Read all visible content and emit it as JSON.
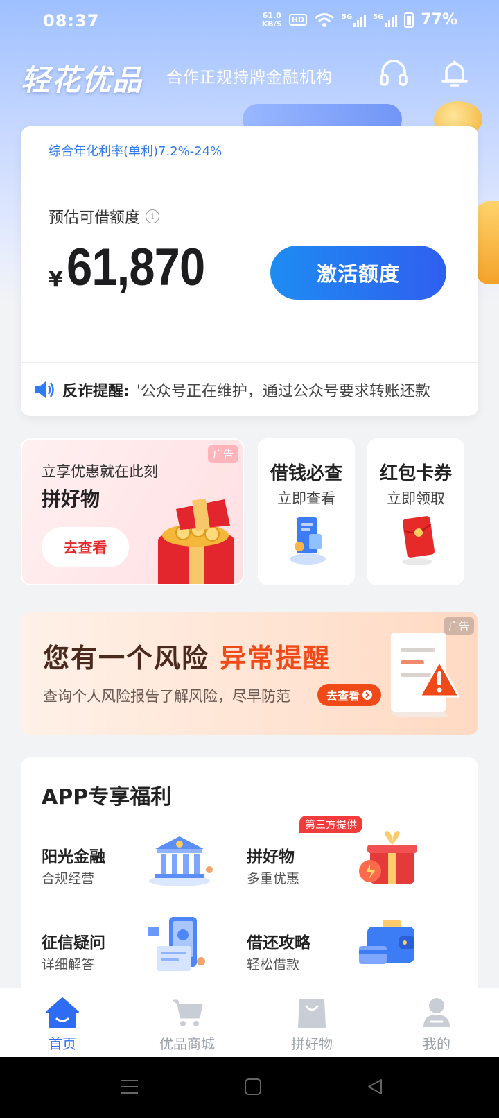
{
  "status_bar": {
    "time": "08:37",
    "net_speed_value": "61.0",
    "net_speed_unit": "KB/S",
    "hd_label": "HD",
    "sig1_label": "5G",
    "sig2_label": "5G",
    "battery_pct": "77%"
  },
  "header": {
    "brand": "轻花优品",
    "tagline": "合作正规持牌金融机构",
    "icons": [
      "headset-icon",
      "bell-icon"
    ]
  },
  "credit": {
    "rate": "综合年化利率(单利)7.2%-24%",
    "quota_label": "预估可借额度",
    "currency": "¥",
    "amount": "61,870",
    "activate_label": "激活额度",
    "notice_title": "反诈提醒:",
    "notice_text": "'公众号正在维护，通过公众号要求转账还款"
  },
  "promos": {
    "big": {
      "ad": "广告",
      "sub": "立享优惠就在此刻",
      "title": "拼好物",
      "button": "去查看"
    },
    "check": {
      "title": "借钱必查",
      "sub": "立即查看"
    },
    "coupon": {
      "title": "红包卡券",
      "sub": "立即领取"
    }
  },
  "risk": {
    "ad": "广告",
    "title_a": "您有一个风险",
    "title_b": "异常提醒",
    "sub": "查询个人风险报告了解风险，尽早防范",
    "button": "去查看"
  },
  "benefits": {
    "title": "APP专享福利",
    "items": [
      {
        "name": "阳光金融",
        "desc": "合规经营"
      },
      {
        "name": "拼好物",
        "desc": "多重优惠",
        "badge": "第三方提供"
      },
      {
        "name": "征信疑问",
        "desc": "详细解答"
      },
      {
        "name": "借还攻略",
        "desc": "轻松借款"
      }
    ]
  },
  "tabs": [
    {
      "label": "首页",
      "active": true
    },
    {
      "label": "优品商城"
    },
    {
      "label": "拼好物"
    },
    {
      "label": "我的"
    }
  ],
  "colors": {
    "accent": "#2d6cf3",
    "alert": "#f04a19",
    "rate_blue": "#2f7bea"
  }
}
